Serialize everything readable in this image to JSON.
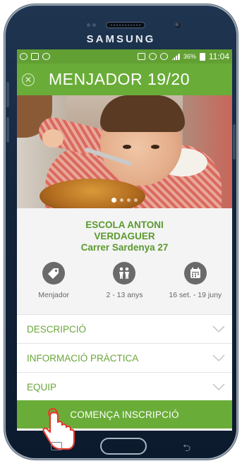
{
  "device": {
    "brand": "SAMSUNG"
  },
  "statusbar": {
    "battery": "36%",
    "time": "11:04"
  },
  "appbar": {
    "title": "MENJADOR 19/20",
    "close_icon": "close-circle-icon"
  },
  "carousel": {
    "page_count": 4,
    "active_index": 0
  },
  "school": {
    "name_line1": "ESCOLA ANTONI",
    "name_line2": "VERDAGUER",
    "address": "Carrer  Sardenya 27"
  },
  "features": [
    {
      "icon": "tag-icon",
      "label": "Menjador"
    },
    {
      "icon": "children-icon",
      "label": "2 - 13 anys"
    },
    {
      "icon": "calendar-icon",
      "label": "16 set. - 19 juny"
    }
  ],
  "accordion": [
    {
      "label": "DESCRIPCIÓ"
    },
    {
      "label": "INFORMACIÓ PRÀCTICA"
    },
    {
      "label": "EQUIP"
    }
  ],
  "cta": {
    "label": "COMENÇA INSCRIPCIÓ"
  },
  "colors": {
    "green": "#6aac38",
    "green_dark": "#62a033",
    "text_green": "#5a9a2e",
    "icon_gray": "#6a6a6a"
  }
}
